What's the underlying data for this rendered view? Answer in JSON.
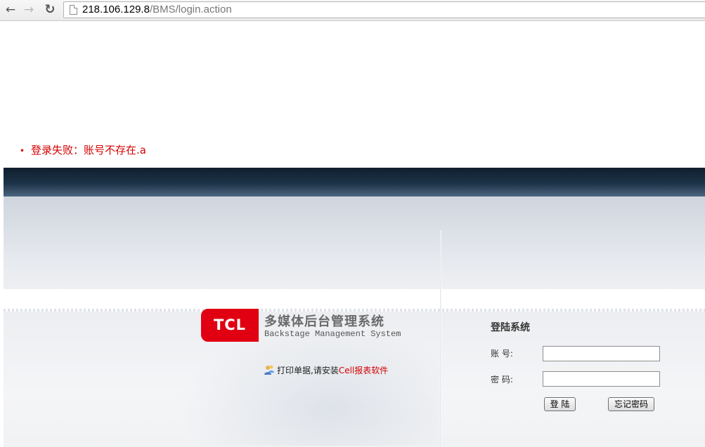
{
  "browser": {
    "url_host": "218.106.129.8",
    "url_path": "/BMS/login.action"
  },
  "error": {
    "bullet": "•",
    "message": "登录失败：账号不存在.a"
  },
  "logo": {
    "mark": "TCL",
    "title_cn": "多媒体后台管理系统",
    "title_en": "Backstage Management System"
  },
  "print_note": {
    "text": "打印单据,请安装",
    "link_text": "Cell报表软件"
  },
  "login": {
    "title": "登陆系统",
    "account_label": "账 号:",
    "password_label": "密 码:",
    "account_value": "",
    "password_value": "",
    "login_button": "登 陆",
    "forgot_button": "忘记密码"
  },
  "colors": {
    "error_red": "#d40000",
    "brand_red": "#e10012",
    "header_dark": "#1d3348"
  }
}
